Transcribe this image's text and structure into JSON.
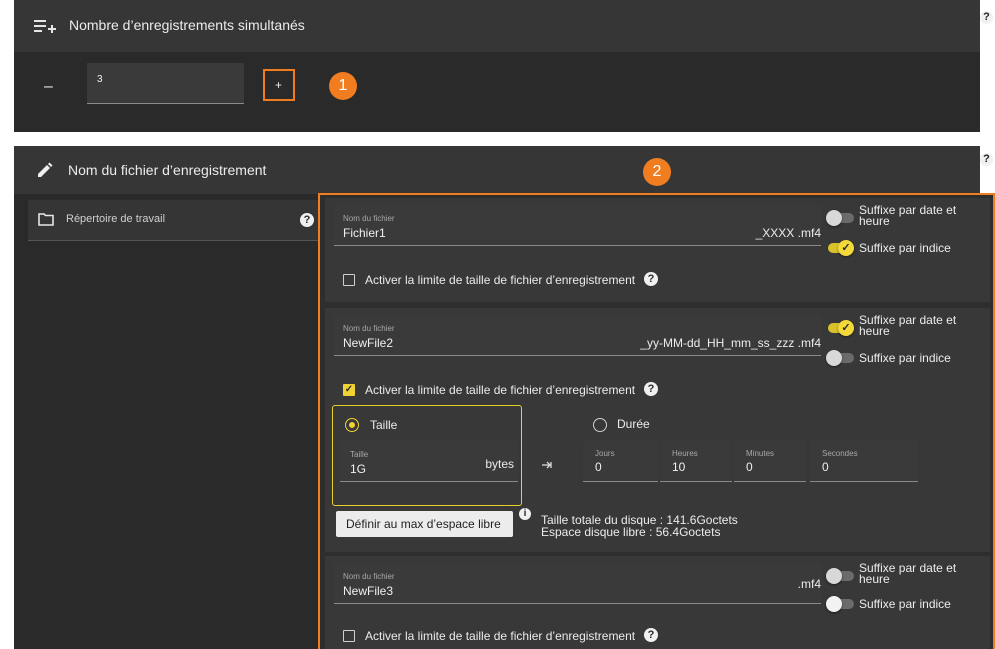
{
  "section1": {
    "title": "Nombre d’enregistrements simultanés",
    "minus": "–",
    "value": "3",
    "plus": "+",
    "badge": "1",
    "help": "?"
  },
  "section2": {
    "title": "Nom du fichier d’enregistrement",
    "badge": "2",
    "help": "?",
    "sidebar_item": "Répertoire de travail",
    "sidebar_help": "?"
  },
  "files": [
    {
      "label": "Nom du fichier",
      "value": "Fichier1",
      "suffix": "_XXXX .mf4",
      "toggle_date": {
        "label": "Suffixe par date et heure",
        "on": false
      },
      "toggle_index": {
        "label": "Suffixe par indice",
        "on": true
      },
      "limit_label": "Activer la limite de taille de fichier d’enregistrement",
      "limit_checked": false
    },
    {
      "label": "Nom du fichier",
      "value": "NewFile2",
      "suffix": "_yy-MM-dd_HH_mm_ss_zzz .mf4",
      "toggle_date": {
        "label": "Suffixe par date et heure",
        "on": true
      },
      "toggle_index": {
        "label": "Suffixe par indice",
        "on": false
      },
      "limit_label": "Activer la limite de taille de fichier d’enregistrement",
      "limit_checked": true,
      "limit": {
        "size_radio": "Taille",
        "size_label": "Taille",
        "size_value": "1G",
        "size_unit": "bytes",
        "duration_radio": "Durée",
        "days_label": "Jours",
        "days_value": "0",
        "hours_label": "Heures",
        "hours_value": "10",
        "minutes_label": "Minutes",
        "minutes_value": "0",
        "seconds_label": "Secondes",
        "seconds_value": "0",
        "max_button": "Définir au max d’espace libre",
        "disk_total": "Taille totale du disque : 141.6Goctets",
        "disk_free": "Espace disque libre : 56.4Goctets"
      }
    },
    {
      "label": "Nom du fichier",
      "value": "NewFile3",
      "suffix": ".mf4",
      "toggle_date": {
        "label": "Suffixe par date et heure",
        "on": false
      },
      "toggle_index": {
        "label": "Suffixe par indice",
        "on": false
      },
      "limit_label": "Activer la limite de taille de fichier d’enregistrement",
      "limit_checked": false
    }
  ],
  "colors": {
    "accent": "#f07d20",
    "highlight": "#f1d232"
  }
}
